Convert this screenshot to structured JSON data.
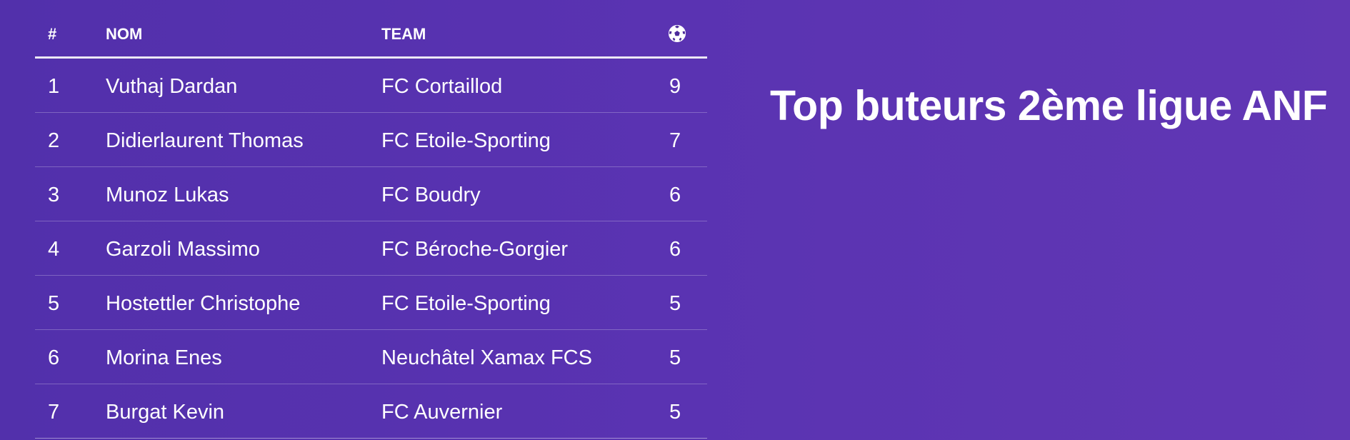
{
  "title": "Top buteurs 2ème ligue ANF",
  "table": {
    "headers": {
      "rank": "#",
      "name": "NOM",
      "team": "TEAM",
      "goals_icon": "soccer-ball-icon"
    },
    "rows": [
      {
        "rank": "1",
        "name": "Vuthaj Dardan",
        "team": "FC Cortaillod",
        "goals": "9"
      },
      {
        "rank": "2",
        "name": "Didierlaurent Thomas",
        "team": "FC Etoile-Sporting",
        "goals": "7"
      },
      {
        "rank": "3",
        "name": "Munoz Lukas",
        "team": "FC Boudry",
        "goals": "6"
      },
      {
        "rank": "4",
        "name": "Garzoli Massimo",
        "team": "FC Béroche-Gorgier",
        "goals": "6"
      },
      {
        "rank": "5",
        "name": "Hostettler Christophe",
        "team": "FC Etoile-Sporting",
        "goals": "5"
      },
      {
        "rank": "6",
        "name": "Morina Enes",
        "team": "Neuchâtel Xamax FCS",
        "goals": "5"
      },
      {
        "rank": "7",
        "name": "Burgat Kevin",
        "team": "FC Auvernier",
        "goals": "5"
      }
    ]
  },
  "colors": {
    "background": "#5a33b2",
    "text": "#ffffff",
    "header_rule": "#ece8f5"
  }
}
